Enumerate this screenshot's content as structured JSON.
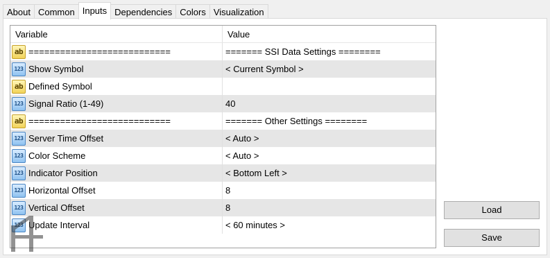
{
  "tabs": [
    "About",
    "Common",
    "Inputs",
    "Dependencies",
    "Colors",
    "Visualization"
  ],
  "active_tab": "Inputs",
  "table": {
    "headers": {
      "variable": "Variable",
      "value": "Value"
    },
    "rows": [
      {
        "icon": "ab",
        "variable": "===========================",
        "value": "======= SSI Data Settings ========"
      },
      {
        "icon": "123",
        "variable": "Show Symbol",
        "value": "< Current Symbol >"
      },
      {
        "icon": "ab",
        "variable": "Defined Symbol",
        "value": ""
      },
      {
        "icon": "123",
        "variable": "Signal Ratio (1-49)",
        "value": "40"
      },
      {
        "icon": "ab",
        "variable": "===========================",
        "value": "======= Other Settings ========"
      },
      {
        "icon": "123",
        "variable": "Server Time Offset",
        "value": "< Auto >"
      },
      {
        "icon": "123",
        "variable": "Color Scheme",
        "value": "< Auto >"
      },
      {
        "icon": "123",
        "variable": "Indicator Position",
        "value": "< Bottom Left >"
      },
      {
        "icon": "123",
        "variable": "Horizontal Offset",
        "value": "8"
      },
      {
        "icon": "123",
        "variable": "Vertical Offset",
        "value": "8"
      },
      {
        "icon": "123",
        "variable": "Update Interval",
        "value": "< 60 minutes >"
      }
    ]
  },
  "buttons": {
    "load": "Load",
    "save": "Save"
  },
  "icon_names": {
    "ab": "string-type-icon",
    "123": "numeric-type-icon",
    "logo": "watermark-logo"
  },
  "colors": {
    "alt_row": "#e6e6e6",
    "string_icon": "#f2d35a",
    "numeric_icon": "#8fc2f0"
  }
}
